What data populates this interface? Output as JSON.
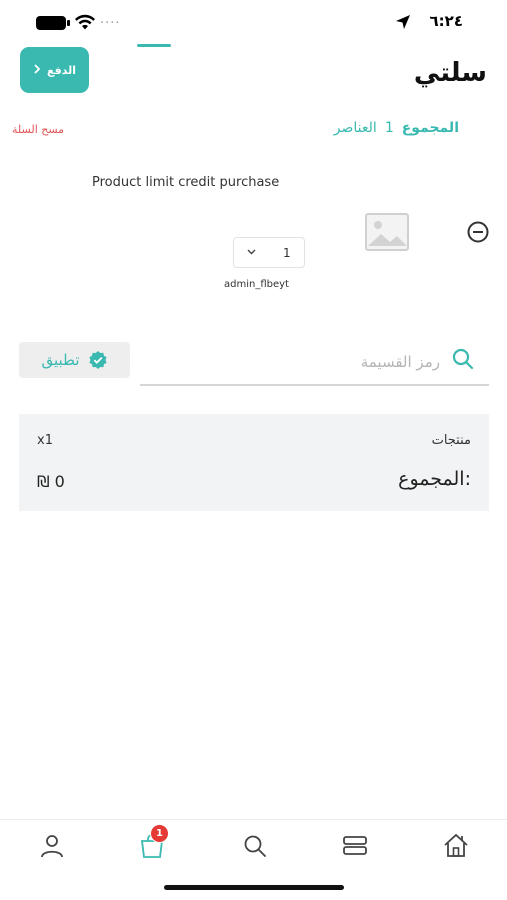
{
  "status_bar": {
    "time": "٦:٢٤",
    "signal_text": "....",
    "icons": [
      "location-arrow-icon",
      "wifi-icon",
      "battery-icon"
    ]
  },
  "header": {
    "title": "سلتي",
    "pay_button_label": "الدفع",
    "pay_button_icon": "chevron-right-icon"
  },
  "summary": {
    "total_label": "المجموع",
    "items_count": "1",
    "items_label": "العناصر",
    "clear_cart_label": "مسح السلة"
  },
  "cart_items": [
    {
      "name": "Product limit credit purchase",
      "quantity": "1",
      "seller": "admin_flbeyt",
      "image": "image-placeholder-icon",
      "remove_icon": "minus-circle-icon"
    }
  ],
  "coupon": {
    "placeholder": "رمز القسيمة",
    "apply_label": "تطبيق"
  },
  "totals": {
    "products_label": "منتجات",
    "products_value": "x1",
    "total_label": "المجموع:",
    "total_value": "₪ 0"
  },
  "bottom_nav": {
    "items": [
      {
        "name": "home",
        "icon": "home-icon"
      },
      {
        "name": "categories",
        "icon": "categories-icon"
      },
      {
        "name": "search",
        "icon": "search-icon"
      },
      {
        "name": "cart",
        "icon": "cart-icon",
        "badge": "1",
        "active": true
      },
      {
        "name": "account",
        "icon": "user-icon"
      }
    ]
  },
  "colors": {
    "accent": "#3ab9b0",
    "danger": "#e05555",
    "badge": "#e53935",
    "panel": "#f2f3f4"
  }
}
